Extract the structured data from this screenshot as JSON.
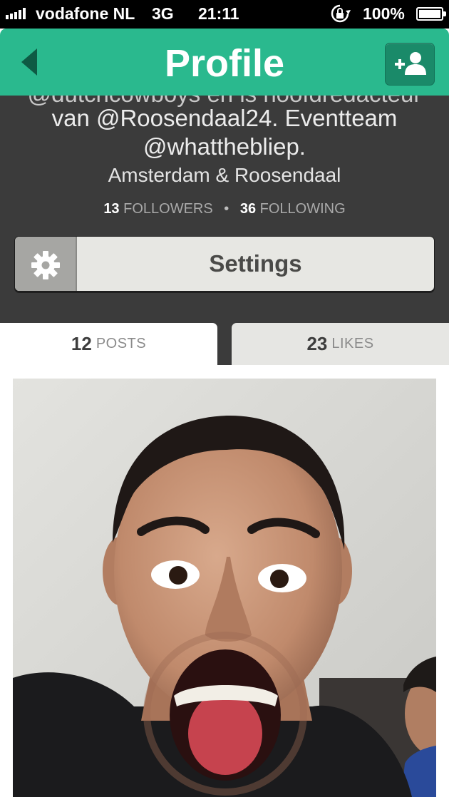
{
  "status_bar": {
    "carrier": "vodafone NL",
    "network": "3G",
    "time": "21:11",
    "battery": "100%",
    "signal_bars": 5,
    "lock_icon": "rotation-lock-icon",
    "battery_icon": "battery-icon"
  },
  "header": {
    "title": "Profile",
    "back_icon": "back-arrow-icon",
    "find_friends_icon": "add-friends-icon",
    "color": "#2ab98e"
  },
  "profile": {
    "bio_partial": "@dutchcowboys en is hoofdredacteur",
    "bio_line1": "van @Roosendaal24. Eventteam",
    "bio_line2": "@whatthebliep.",
    "location": "Amsterdam & Roosendaal",
    "followers_count": "13",
    "followers_label": "FOLLOWERS",
    "separator": "•",
    "following_count": "36",
    "following_label": "FOLLOWING",
    "background": "#3b3b3b"
  },
  "settings": {
    "label": "Settings",
    "icon": "gear-icon"
  },
  "tabs": [
    {
      "count": "12",
      "label": "POSTS",
      "active": true
    },
    {
      "count": "23",
      "label": "LIKES",
      "active": false
    }
  ],
  "post": {
    "media": "video-thumbnail"
  }
}
